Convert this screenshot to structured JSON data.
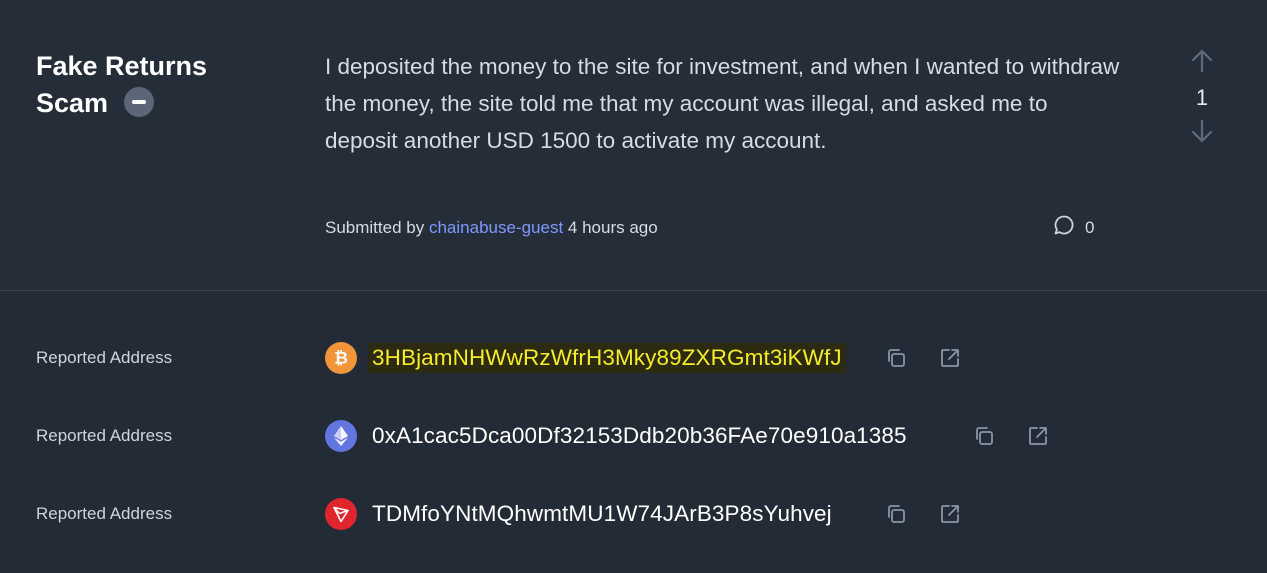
{
  "report": {
    "category_line1": "Fake Returns",
    "category_line2": "Scam",
    "description": "I deposited the money to the site for investment, and when I wanted to withdraw the money, the site told me that my account was illegal, and asked me to deposit another USD 1500 to activate my account.",
    "vote_count": "1",
    "submitted_prefix": "Submitted by",
    "author": "chainabuse-guest",
    "time_ago": "4 hours ago",
    "comment_count": "0"
  },
  "addresses": [
    {
      "label": "Reported Address",
      "coin_icon": "bitcoin-icon",
      "address": "3HBjamNHWwRzWfrH3Mky89ZXRGmt3iKWfJ",
      "highlighted": true
    },
    {
      "label": "Reported Address",
      "coin_icon": "ethereum-icon",
      "address": "0xA1cac5Dca00Df32153Ddb20b36FAe70e910a1385",
      "highlighted": false
    },
    {
      "label": "Reported Address",
      "coin_icon": "tron-icon",
      "address": "TDMfoYNtMQhwmtMU1W74JArB3P8sYuhvej",
      "highlighted": false
    }
  ],
  "colors": {
    "background": "#252d38",
    "accent_link": "#7f98ff",
    "highlight_text": "#f4ec2c",
    "bitcoin": "#f0953a",
    "ethereum": "#6376e0",
    "tron": "#e0262c"
  }
}
